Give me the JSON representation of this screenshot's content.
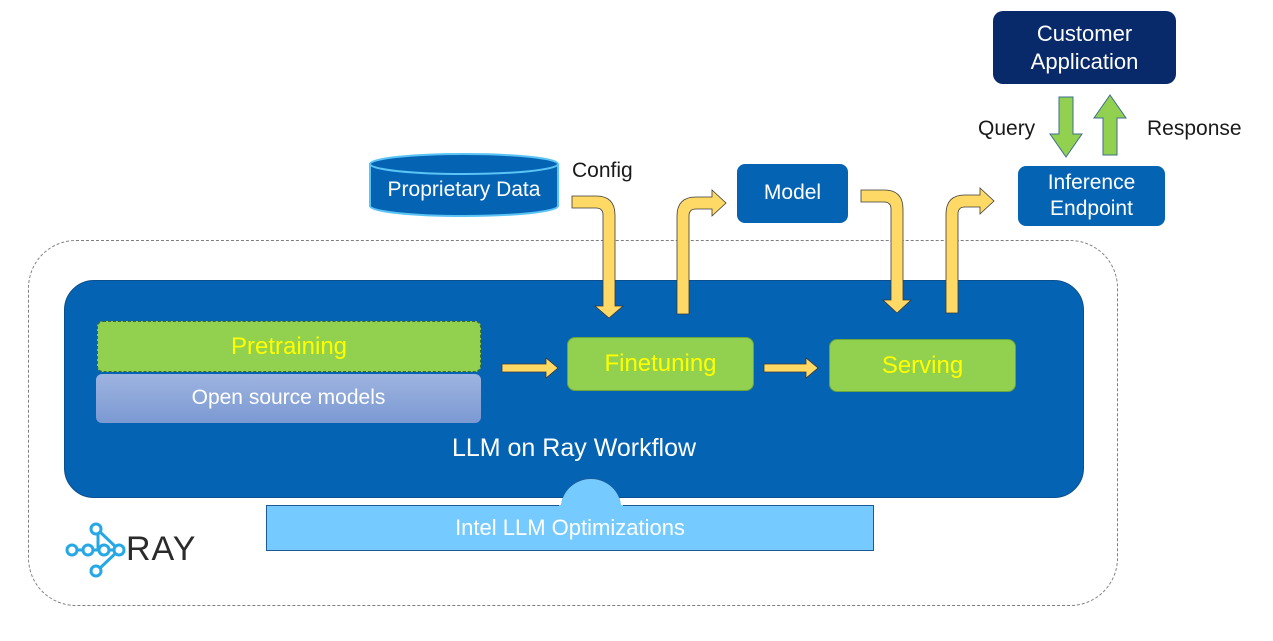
{
  "diagram": {
    "title": "LLM on Ray Workflow",
    "nodes": {
      "customer_application": "Customer Application",
      "inference_endpoint": "Inference Endpoint",
      "model": "Model",
      "proprietary_data": "Proprietary Data",
      "pretraining": "Pretraining",
      "open_source_models": "Open source models",
      "finetuning": "Finetuning",
      "serving": "Serving",
      "intel_optimizations": "Intel LLM Optimizations"
    },
    "labels": {
      "config": "Config",
      "query": "Query",
      "response": "Response"
    },
    "logo": {
      "icon": "ray-logo-icon",
      "text": "RAY"
    },
    "edges": [
      {
        "from": "Pretraining",
        "to": "Finetuning"
      },
      {
        "from": "Finetuning",
        "to": "Serving"
      },
      {
        "from": "Proprietary Data",
        "to": "Finetuning",
        "label": "Config"
      },
      {
        "from": "Finetuning",
        "to": "Model"
      },
      {
        "from": "Model",
        "to": "Serving"
      },
      {
        "from": "Serving",
        "to": "Inference Endpoint"
      },
      {
        "from": "Customer Application",
        "to": "Inference Endpoint",
        "label": "Query"
      },
      {
        "from": "Inference Endpoint",
        "to": "Customer Application",
        "label": "Response"
      }
    ],
    "colors": {
      "workflow_blue": "#0563b4",
      "stage_green": "#92d050",
      "stage_text": "#ffff00",
      "arrow_yellow": "#ffd966",
      "arrow_green": "#92d050",
      "intel_blue": "#75caff",
      "customer_navy": "#082a6a",
      "ray_blue": "#27a8e6"
    }
  }
}
